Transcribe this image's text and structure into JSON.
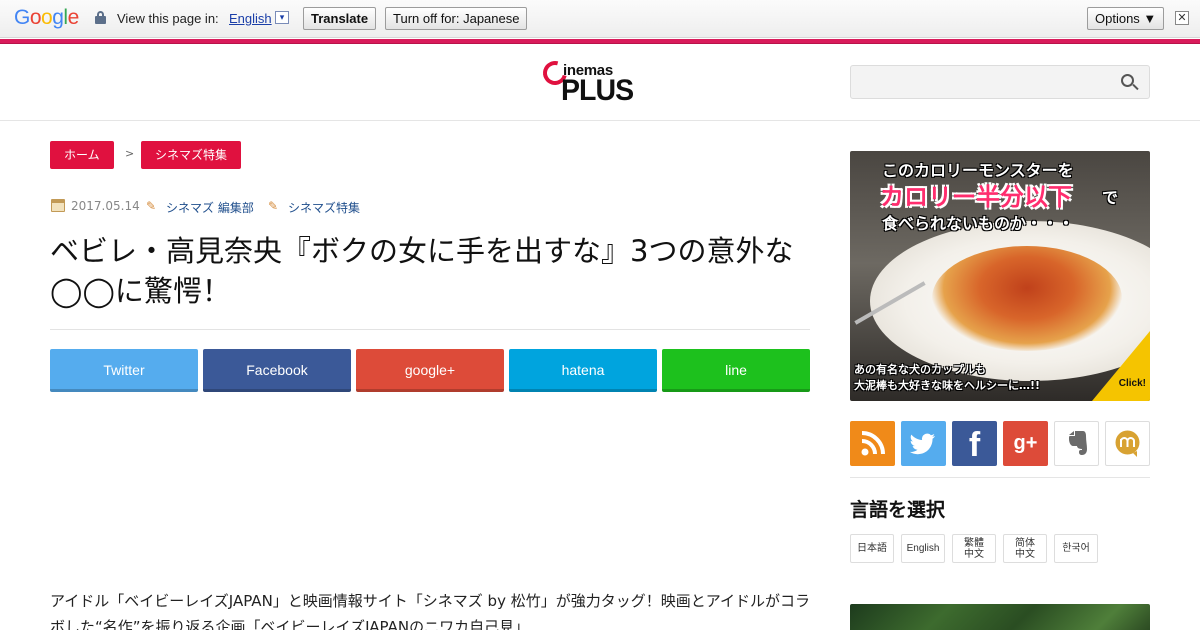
{
  "translate_bar": {
    "logo": "Google",
    "view_text": "View this page in:",
    "language": "English",
    "dropdown_glyph": "▾",
    "translate_label": "Translate",
    "turn_off_label": "Turn off for: Japanese",
    "options_label": "Options ▼",
    "close_glyph": "✕"
  },
  "header": {
    "logo_top": "inemas",
    "logo_bottom": "PLUS",
    "search_placeholder": ""
  },
  "breadcrumb": {
    "home": "ホーム",
    "separator": ">",
    "category": "シネマズ特集"
  },
  "meta": {
    "date": "2017.05.14",
    "author": "シネマズ 編集部",
    "category": "シネマズ特集"
  },
  "article": {
    "title": "ベビレ・高見奈央『ボクの女に手を出すな』3つの意外な◯◯に驚愕！",
    "body": "アイドル「ベイビーレイズJAPAN」と映画情報サイト「シネマズ by 松竹」が強力タッグ！映画とアイドルがコラボした“名作”を振り返る企画「ベイビーレイズJAPANのニワカ自己見」"
  },
  "share_buttons": [
    {
      "label": "Twitter",
      "color": "#55acee"
    },
    {
      "label": "Facebook",
      "color": "#3b5998"
    },
    {
      "label": "google+",
      "color": "#dd4b39"
    },
    {
      "label": "hatena",
      "color": "#00a4de"
    },
    {
      "label": "line",
      "color": "#1dc11d"
    }
  ],
  "sidebar": {
    "ad": {
      "line1": "このカロリーモンスターを",
      "line2": "カロリー半分以下",
      "line2_tail": "で",
      "line3": "食べられないものか・・・",
      "caption_1": "あの有名な犬のカップルも",
      "caption_2": "大泥棒も大好きな味をヘルシーに…!!",
      "click": "Click!"
    },
    "social_icons": [
      "rss-icon",
      "twitter-icon",
      "facebook-icon",
      "google-plus-icon",
      "evernote-icon",
      "mixi-icon"
    ],
    "google_plus_label": "g+",
    "facebook_label": "f",
    "language_heading": "言語を選択",
    "languages": {
      "ja": "日本語",
      "en": "English",
      "zh_tw_1": "繁體",
      "zh_tw_2": "中文",
      "zh_cn_1": "简体",
      "zh_cn_2": "中文",
      "ko": "한국어"
    }
  },
  "colors": {
    "brand_pink": "#e0113f",
    "link_blue": "#1f4e8c"
  }
}
